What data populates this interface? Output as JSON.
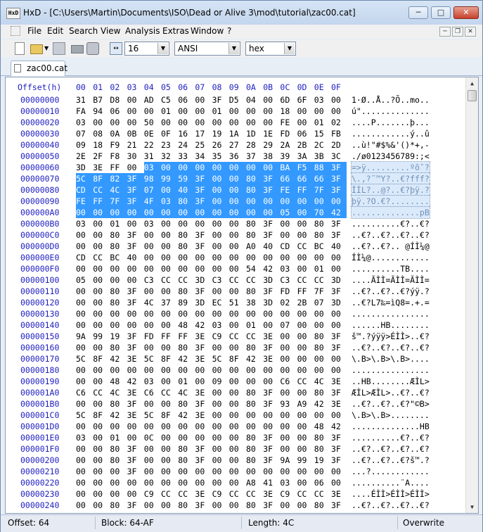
{
  "window": {
    "app_icon_text": "HxD",
    "title": "HxD - [C:\\Users\\Martin\\Documents\\ISO\\Dead or Alive 3\\mod\\tutorial\\zac00.cat]",
    "minimize": "─",
    "maximize": "□",
    "close": "✕"
  },
  "menu": {
    "items": [
      "File",
      "Edit",
      "Search",
      "View",
      "Analysis",
      "Extras",
      "Window",
      "?"
    ],
    "mdi_minimize": "─",
    "mdi_restore": "❐",
    "mdi_close": "✕"
  },
  "toolbar": {
    "bytes_per_row": "16",
    "charset": "ANSI",
    "offset_base": "hex",
    "icons": [
      "new-file-icon",
      "open-folder-icon",
      "save-icon",
      "ram-editor-icon",
      "disk-editor-icon",
      "bytes-per-row-icon"
    ]
  },
  "tab": {
    "label": "zac00.cat"
  },
  "hex_header": {
    "offset_label": "Offset(h)",
    "columns": [
      "00",
      "01",
      "02",
      "03",
      "04",
      "05",
      "06",
      "07",
      "08",
      "09",
      "0A",
      "0B",
      "0C",
      "0D",
      "0E",
      "0F"
    ]
  },
  "rows": [
    {
      "offset": "00000000",
      "bytes": "31 B7 D8 00 AD C5 06 00 3F D5 04 00 6D 6F 03 00",
      "text": "1·Ø..Å..?Õ..mo.."
    },
    {
      "offset": "00000010",
      "bytes": "FA 94 06 00 00 01 00 00 01 00 00 00 18 00 00 00",
      "text": "ú\".............."
    },
    {
      "offset": "00000020",
      "bytes": "03 00 00 00 50 00 00 00 00 00 00 00 FE 00 01 02",
      "text": "....P.......þ..."
    },
    {
      "offset": "00000030",
      "bytes": "07 08 0A 0B 0E 0F 16 17 19 1A 1D 1E FD 06 15 FB",
      "text": "............ý..û"
    },
    {
      "offset": "00000040",
      "bytes": "09 18 F9 21 22 23 24 25 26 27 28 29 2A 2B 2C 2D",
      "text": "..ù!\"#$%&'()*+,-"
    },
    {
      "offset": "00000050",
      "bytes": "2E 2F F8 30 31 32 33 34 35 36 37 38 39 3A 3B 3C",
      "text": "./ø0123456789:;<"
    },
    {
      "offset": "00000060",
      "bytes": "3D 3E FF 00 03 00 00 00 00 00 00 00 BA F5 88 3F",
      "text": "=>ÿ.........ºõˆ?"
    },
    {
      "offset": "00000070",
      "bytes": "5C 8F 82 3F 98 99 59 3F 00 00 80 3F 66 66 66 3F",
      "text": "\\.‚?˜™Y?..€?fff?"
    },
    {
      "offset": "00000080",
      "bytes": "CD CC 4C 3F 07 00 40 3F 00 00 80 3F FE FF 7F 3F",
      "text": "ÍÌL?..@?..€?þÿ.?"
    },
    {
      "offset": "00000090",
      "bytes": "FE FF 7F 3F 4F 03 80 3F 00 00 00 00 00 00 00 00",
      "text": "þÿ.?O.€?........"
    },
    {
      "offset": "000000A0",
      "bytes": "00 00 00 00 00 00 00 00 00 00 00 00 05 00 70 42",
      "text": "..............pB"
    },
    {
      "offset": "000000B0",
      "bytes": "03 00 01 00 03 00 00 00 00 00 80 3F 00 00 80 3F",
      "text": "..........€?..€?"
    },
    {
      "offset": "000000C0",
      "bytes": "00 00 80 3F 00 00 80 3F 00 00 80 3F 00 00 80 3F",
      "text": "..€?..€?..€?..€?"
    },
    {
      "offset": "000000D0",
      "bytes": "00 00 80 3F 00 00 80 3F 00 00 A0 40 CD CC BC 40",
      "text": "..€?..€?.. @ÍÌ¼@"
    },
    {
      "offset": "000000E0",
      "bytes": "CD CC BC 40 00 00 00 00 00 00 00 00 00 00 00 00",
      "text": "ÍÌ¼@............"
    },
    {
      "offset": "000000F0",
      "bytes": "00 00 00 00 00 00 00 00 00 00 54 42 03 00 01 00",
      "text": "..........TB...."
    },
    {
      "offset": "00000100",
      "bytes": "05 00 00 00 C3 CC CC 3D C3 CC CC 3D C3 CC CC 3D",
      "text": "....ÃÌÌ=ÃÌÌ=ÃÌÌ="
    },
    {
      "offset": "00000110",
      "bytes": "00 00 80 3F 00 00 80 3F 00 00 80 3F FD FF 7F 3F",
      "text": "..€?..€?..€?ýÿ.?"
    },
    {
      "offset": "00000120",
      "bytes": "00 00 80 3F 4C 37 89 3D EC 51 38 3D 02 2B 07 3D",
      "text": "..€?L7‰=ìQ8=.+.="
    },
    {
      "offset": "00000130",
      "bytes": "00 00 00 00 00 00 00 00 00 00 00 00 00 00 00 00",
      "text": "................"
    },
    {
      "offset": "00000140",
      "bytes": "00 00 00 00 00 00 48 42 03 00 01 00 07 00 00 00",
      "text": "......HB........"
    },
    {
      "offset": "00000150",
      "bytes": "9A 99 19 3F FD FF FF 3E C9 CC CC 3E 00 00 80 3F",
      "text": "š™.?ýÿÿ>ÉÌÌ>..€?"
    },
    {
      "offset": "00000160",
      "bytes": "00 00 80 3F 00 00 80 3F 00 00 80 3F 00 00 80 3F",
      "text": "..€?..€?..€?..€?"
    },
    {
      "offset": "00000170",
      "bytes": "5C 8F 42 3E 5C 8F 42 3E 5C 8F 42 3E 00 00 00 00",
      "text": "\\.B>\\.B>\\.B>...."
    },
    {
      "offset": "00000180",
      "bytes": "00 00 00 00 00 00 00 00 00 00 00 00 00 00 00 00",
      "text": "................"
    },
    {
      "offset": "00000190",
      "bytes": "00 00 48 42 03 00 01 00 09 00 00 00 C6 CC 4C 3E",
      "text": "..HB........ÆÌL>"
    },
    {
      "offset": "000001A0",
      "bytes": "C6 CC 4C 3E C6 CC 4C 3E 00 00 80 3F 00 00 80 3F",
      "text": "ÆÌL>ÆÌL>..€?..€?"
    },
    {
      "offset": "000001B0",
      "bytes": "00 00 80 3F 00 00 80 3F 00 00 80 3F 93 A9 42 3E",
      "text": "..€?..€?..€?\"©B>"
    },
    {
      "offset": "000001C0",
      "bytes": "5C 8F 42 3E 5C 8F 42 3E 00 00 00 00 00 00 00 00",
      "text": "\\.B>\\.B>........"
    },
    {
      "offset": "000001D0",
      "bytes": "00 00 00 00 00 00 00 00 00 00 00 00 00 00 48 42",
      "text": "..............HB"
    },
    {
      "offset": "000001E0",
      "bytes": "03 00 01 00 0C 00 00 00 00 00 80 3F 00 00 80 3F",
      "text": "..........€?..€?"
    },
    {
      "offset": "000001F0",
      "bytes": "00 00 80 3F 00 00 80 3F 00 00 80 3F 00 00 80 3F",
      "text": "..€?..€?..€?..€?"
    },
    {
      "offset": "00000200",
      "bytes": "00 00 80 3F 00 00 80 3F 00 00 80 3F 9A 99 19 3F",
      "text": "..€?..€?..€?š™.?"
    },
    {
      "offset": "00000210",
      "bytes": "00 00 00 3F 00 00 00 00 00 00 00 00 00 00 00 00",
      "text": "...?............"
    },
    {
      "offset": "00000220",
      "bytes": "00 00 00 00 00 00 00 00 00 00 A8 41 03 00 06 00",
      "text": "..........¨A...."
    },
    {
      "offset": "00000230",
      "bytes": "00 00 00 00 C9 CC CC 3E C9 CC CC 3E C9 CC CC 3E",
      "text": "....ÉÌÌ>ÉÌÌ>ÉÌÌ>"
    },
    {
      "offset": "00000240",
      "bytes": "00 00 80 3F 00 00 80 3F 00 00 80 3F 00 00 80 3F",
      "text": "..€?..€?..€?..€?"
    }
  ],
  "selection": {
    "start": 100,
    "end": 175,
    "color": "#3399ff"
  },
  "status": {
    "offset": "Offset: 64",
    "block": "Block: 64-AF",
    "length": "Length: 4C",
    "mode": "Overwrite"
  }
}
